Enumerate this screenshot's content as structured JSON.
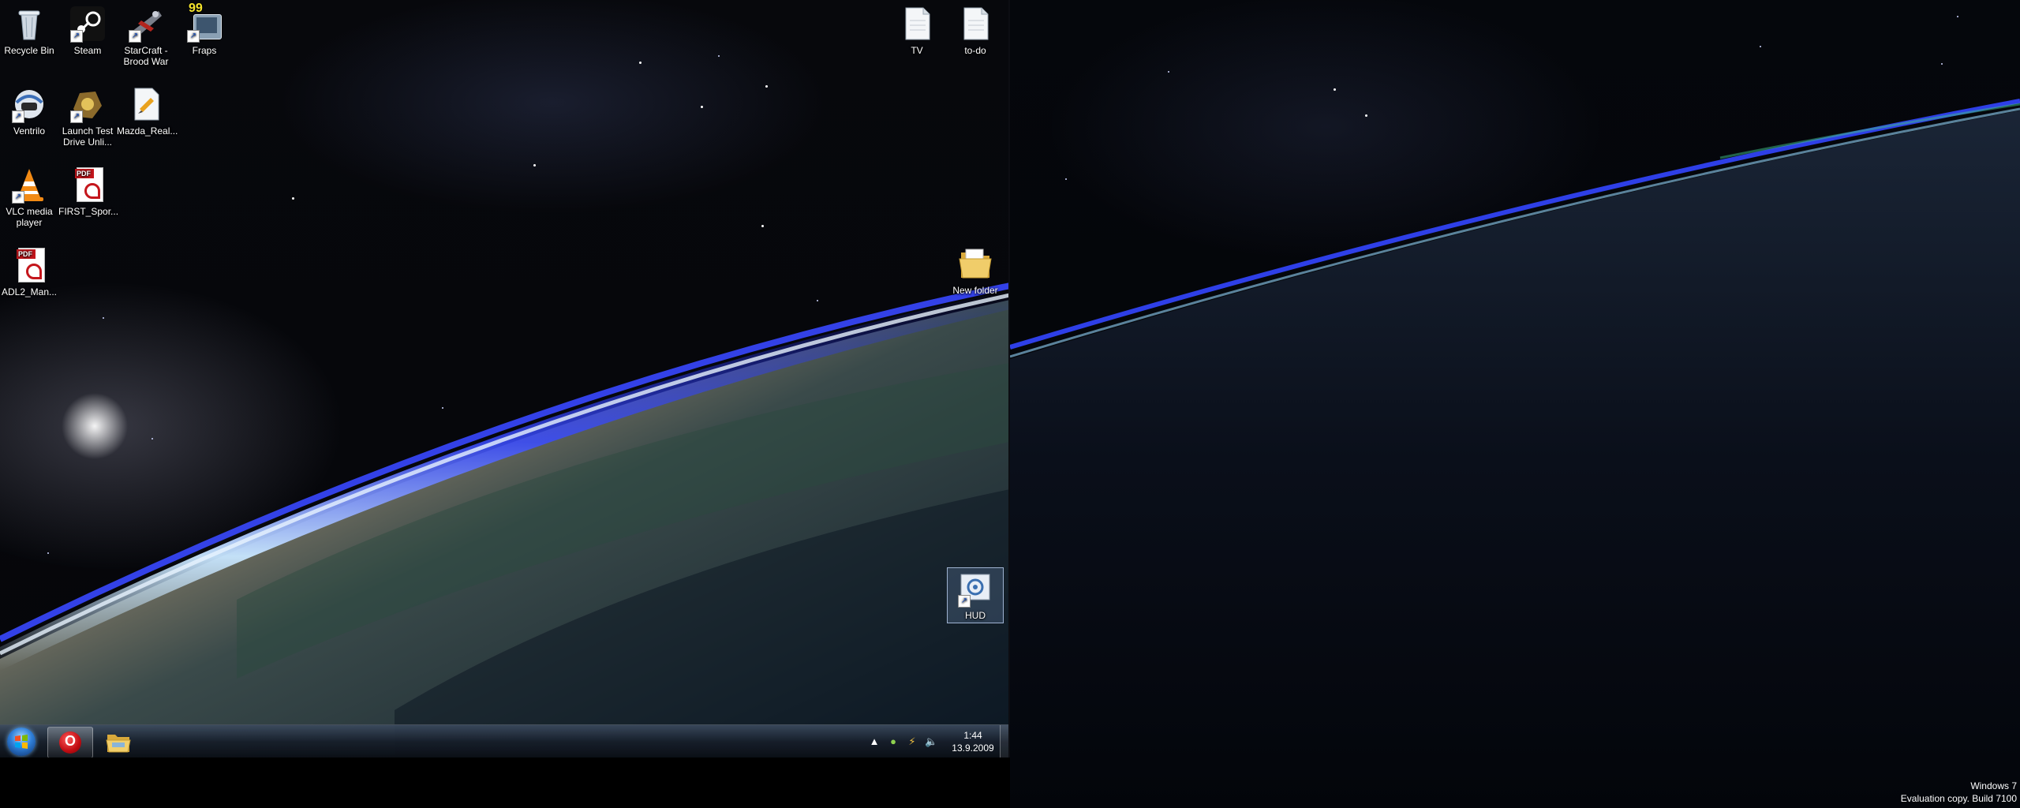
{
  "desktop_left": {
    "icons": [
      {
        "label": "Recycle Bin",
        "icon": "recycle-bin-icon"
      },
      {
        "label": "Steam",
        "icon": "steam-icon"
      },
      {
        "label": "StarCraft - Brood War",
        "icon": "starcraft-icon"
      },
      {
        "label": "Fraps",
        "icon": "fraps-icon",
        "badge": "99"
      },
      {
        "label": "Ventrilo",
        "icon": "ventrilo-icon"
      },
      {
        "label": "Launch Test Drive Unli...",
        "icon": "test-drive-icon"
      },
      {
        "label": "Mazda_Real...",
        "icon": "document-icon"
      },
      {
        "label": "VLC media player",
        "icon": "vlc-icon"
      },
      {
        "label": "FIRST_Spor...",
        "icon": "pdf-icon",
        "badge": "PDF"
      },
      {
        "label": "ADL2_Man...",
        "icon": "pdf-icon",
        "badge": "PDF"
      },
      {
        "label": "TV",
        "icon": "text-file-icon"
      },
      {
        "label": "to-do",
        "icon": "text-file-icon"
      },
      {
        "label": "New folder",
        "icon": "folder-icon"
      },
      {
        "label": "HUD",
        "icon": "hud-shortcut-icon"
      }
    ]
  },
  "taskbar": {
    "start_label": "Start",
    "pinned": [
      {
        "name": "Opera",
        "icon": "opera-icon",
        "letter": "O"
      },
      {
        "name": "Windows Explorer",
        "icon": "explorer-icon"
      }
    ],
    "clock": {
      "time": "1:44",
      "date": "13.9.2009"
    }
  },
  "watermark": {
    "line1": "Windows 7",
    "line2": "Evaluation copy. Build 7100"
  },
  "colors": {
    "atmosphere": "#3a4cff",
    "taskbar": "#16202c",
    "start_orb": "#2f7fd8",
    "opera_red": "#cc0f16",
    "folder_yellow": "#e8c25a"
  }
}
